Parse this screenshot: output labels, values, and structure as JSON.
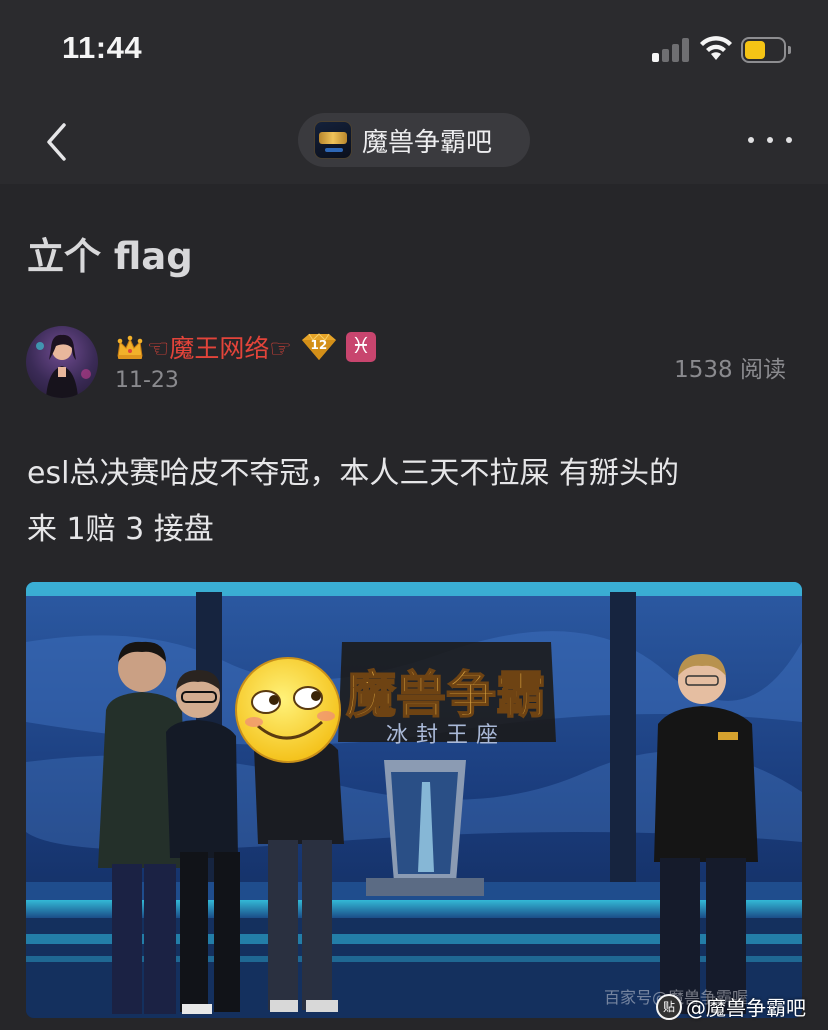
{
  "status_bar": {
    "time": "11:44",
    "signal_bars_active": 1,
    "signal_bars_total": 4,
    "battery_level": 0.55,
    "battery_color": "#f5c415"
  },
  "nav": {
    "back_icon": "chevron-left",
    "forum_name": "魔兽争霸吧",
    "more_icon": "ellipsis-horizontal"
  },
  "post": {
    "title": "立个 flag",
    "author": {
      "name": "☜魔王网络☞",
      "name_color": "#e3443a",
      "crown_icon": "crown",
      "level": "12",
      "zodiac": "♓",
      "zodiac_color": "#c8456e"
    },
    "date": "11-23",
    "read_count": "1538 阅读",
    "body_line1": "esl总决赛哈皮不夺冠，本人三天不拉屎 有掰头的",
    "body_line2": "来 1赔 3 接盘",
    "image": {
      "banner_text": "魔兽争霸",
      "banner_subtext": "冰封王座",
      "caption": "百家号@魔兽争霸喔",
      "watermark_icon": "贴",
      "watermark_text": "@魔兽争霸吧"
    }
  }
}
